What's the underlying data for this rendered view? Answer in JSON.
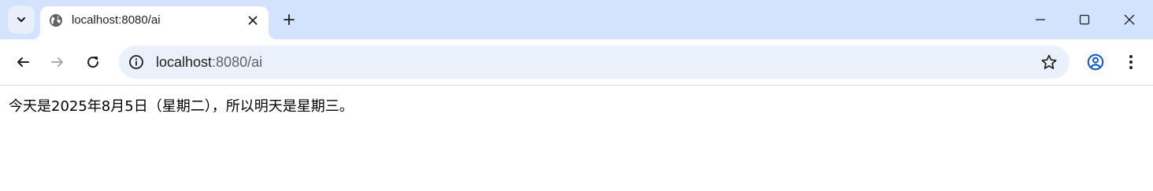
{
  "tab": {
    "title": "localhost:8080/ai"
  },
  "address_bar": {
    "host": "localhost",
    "path": ":8080/ai"
  },
  "page": {
    "content": "今天是2025年8月5日（星期二），所以明天是星期三。"
  },
  "icons": {
    "tab_search": "chevron-down-icon",
    "favicon": "globe-icon",
    "tab_close": "close-icon",
    "new_tab": "plus-icon",
    "minimize": "minimize-icon",
    "maximize": "maximize-icon",
    "close_window": "close-icon",
    "back": "back-arrow-icon",
    "forward": "forward-arrow-icon",
    "reload": "reload-icon",
    "site_info": "info-icon",
    "bookmark": "star-icon",
    "profile": "profile-icon",
    "menu": "kebab-menu-icon"
  },
  "colors": {
    "tabstrip_bg": "#d3e3fd",
    "omnibox_bg": "#ebf1fa",
    "profile_accent": "#0b57d0"
  }
}
